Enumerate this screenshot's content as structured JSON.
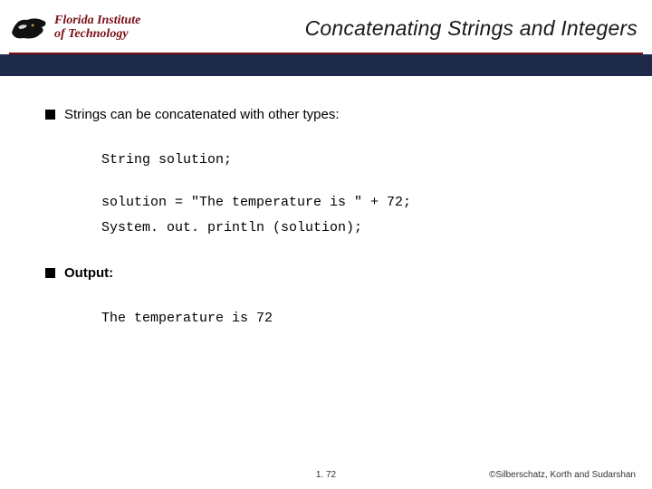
{
  "logo": {
    "line1": "Florida Institute",
    "line2": "of Technology"
  },
  "title": "Concatenating Strings and Integers",
  "bullets": [
    {
      "text": "Strings can be concatenated with other types:",
      "bold": false
    },
    {
      "text": "Output:",
      "bold": true
    }
  ],
  "code": {
    "line1": "String solution;",
    "line2": "solution = \"The temperature is \" + 72;",
    "line3": "System. out. println (solution);"
  },
  "output_line": "The temperature is 72",
  "footer": {
    "page": "1. 72",
    "copyright": "©Silberschatz, Korth and Sudarshan"
  }
}
